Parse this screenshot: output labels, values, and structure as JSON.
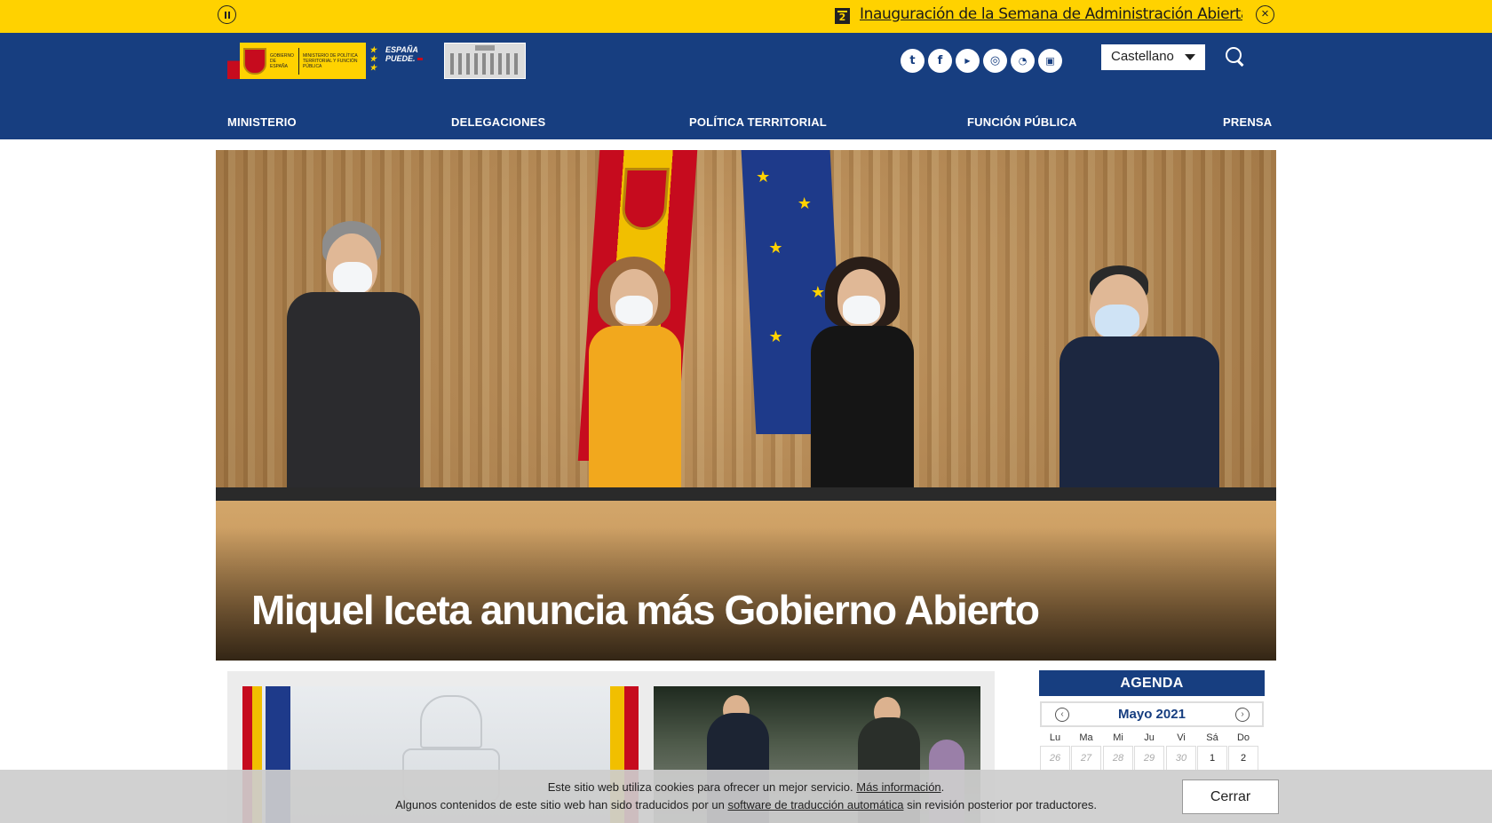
{
  "ticker": {
    "badge": "2",
    "headline": "Inauguración de la Semana de Administración Abierta en el Cor"
  },
  "header": {
    "logo_text_1": "GOBIERNO DE ESPAÑA",
    "logo_text_2": "MINISTERIO DE POLÍTICA TERRITORIAL Y FUNCIÓN PÚBLICA",
    "logo_ep_1": "ESPAÑA",
    "logo_ep_2": "PUEDE.",
    "language": "Castellano",
    "social": [
      "twitter-icon",
      "facebook-icon",
      "youtube-icon",
      "instagram-icon",
      "rss-icon",
      "twitch-icon"
    ]
  },
  "nav": [
    "MINISTERIO",
    "DELEGACIONES",
    "POLÍTICA TERRITORIAL",
    "FUNCIÓN PÚBLICA",
    "PRENSA"
  ],
  "hero": {
    "headline": "Miquel Iceta anuncia más Gobierno Abierto"
  },
  "agenda": {
    "title": "AGENDA",
    "month": "Mayo 2021",
    "weekdays": [
      "Lu",
      "Ma",
      "Mi",
      "Ju",
      "Vi",
      "Sá",
      "Do"
    ],
    "first_row": [
      "26",
      "27",
      "28",
      "29",
      "30",
      "1",
      "2"
    ]
  },
  "cookie": {
    "line1_text": "Este sitio web utiliza cookies para ofrecer un mejor servicio.",
    "line1_link": "Más información",
    "line1_end": ".",
    "line2_text": "Algunos contenidos de este sitio web han sido traducidos por un",
    "line2_link": "software de traducción automática",
    "line2_end": "sin revisión posterior por traductores.",
    "close_button": "Cerrar"
  },
  "colors": {
    "brand_blue": "#173e80",
    "ticker_yellow": "#ffd200"
  }
}
